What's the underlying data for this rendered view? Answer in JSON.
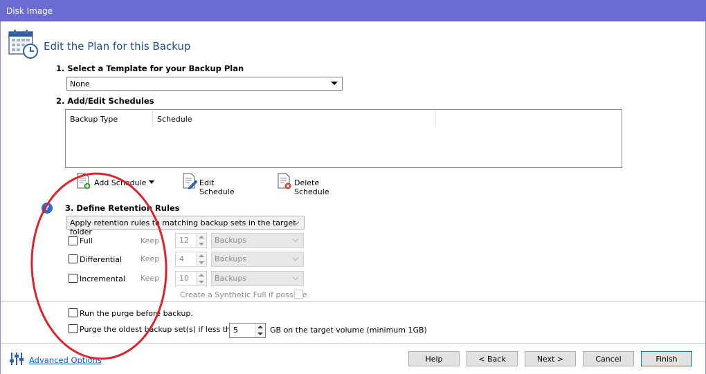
{
  "window": {
    "title": "Disk Image"
  },
  "header": {
    "title": "Edit the Plan for this Backup"
  },
  "template": {
    "label": "1. Select a Template for your Backup Plan",
    "selected": "None"
  },
  "schedules": {
    "label": "2. Add/Edit Schedules",
    "columns": [
      "Backup Type",
      "Schedule"
    ],
    "add_label": "Add Schedule",
    "edit_label": "Edit Schedule",
    "delete_label": "Delete Schedule"
  },
  "retention": {
    "label": "3. Define Retention Rules",
    "mode": "Apply retention rules to matching backup sets in the target folder",
    "rows": [
      {
        "name": "Full",
        "keep": "Keep",
        "value": "12",
        "unit": "Backups",
        "checked": false
      },
      {
        "name": "Differential",
        "keep": "Keep",
        "value": "4",
        "unit": "Backups",
        "checked": false
      },
      {
        "name": "Incremental",
        "keep": "Keep",
        "value": "10",
        "unit": "Backups",
        "checked": false
      }
    ],
    "synthetic_label": "Create a Synthetic Full if possible"
  },
  "purge": {
    "run_before_label": "Run the purge before backup.",
    "oldest_label": "Purge the oldest backup set(s) if less than",
    "oldest_value": "5",
    "oldest_suffix": "GB on the target volume (minimum 1GB)"
  },
  "footer": {
    "advanced_label": "Advanced Options",
    "help": "Help",
    "back": "< Back",
    "next": "Next >",
    "cancel": "Cancel",
    "finish": "Finish"
  },
  "colors": {
    "titlebar": "#6b6bd2",
    "header_text": "#1f4e8f",
    "annotation": "#d9242f",
    "link": "#0b5bc4"
  }
}
